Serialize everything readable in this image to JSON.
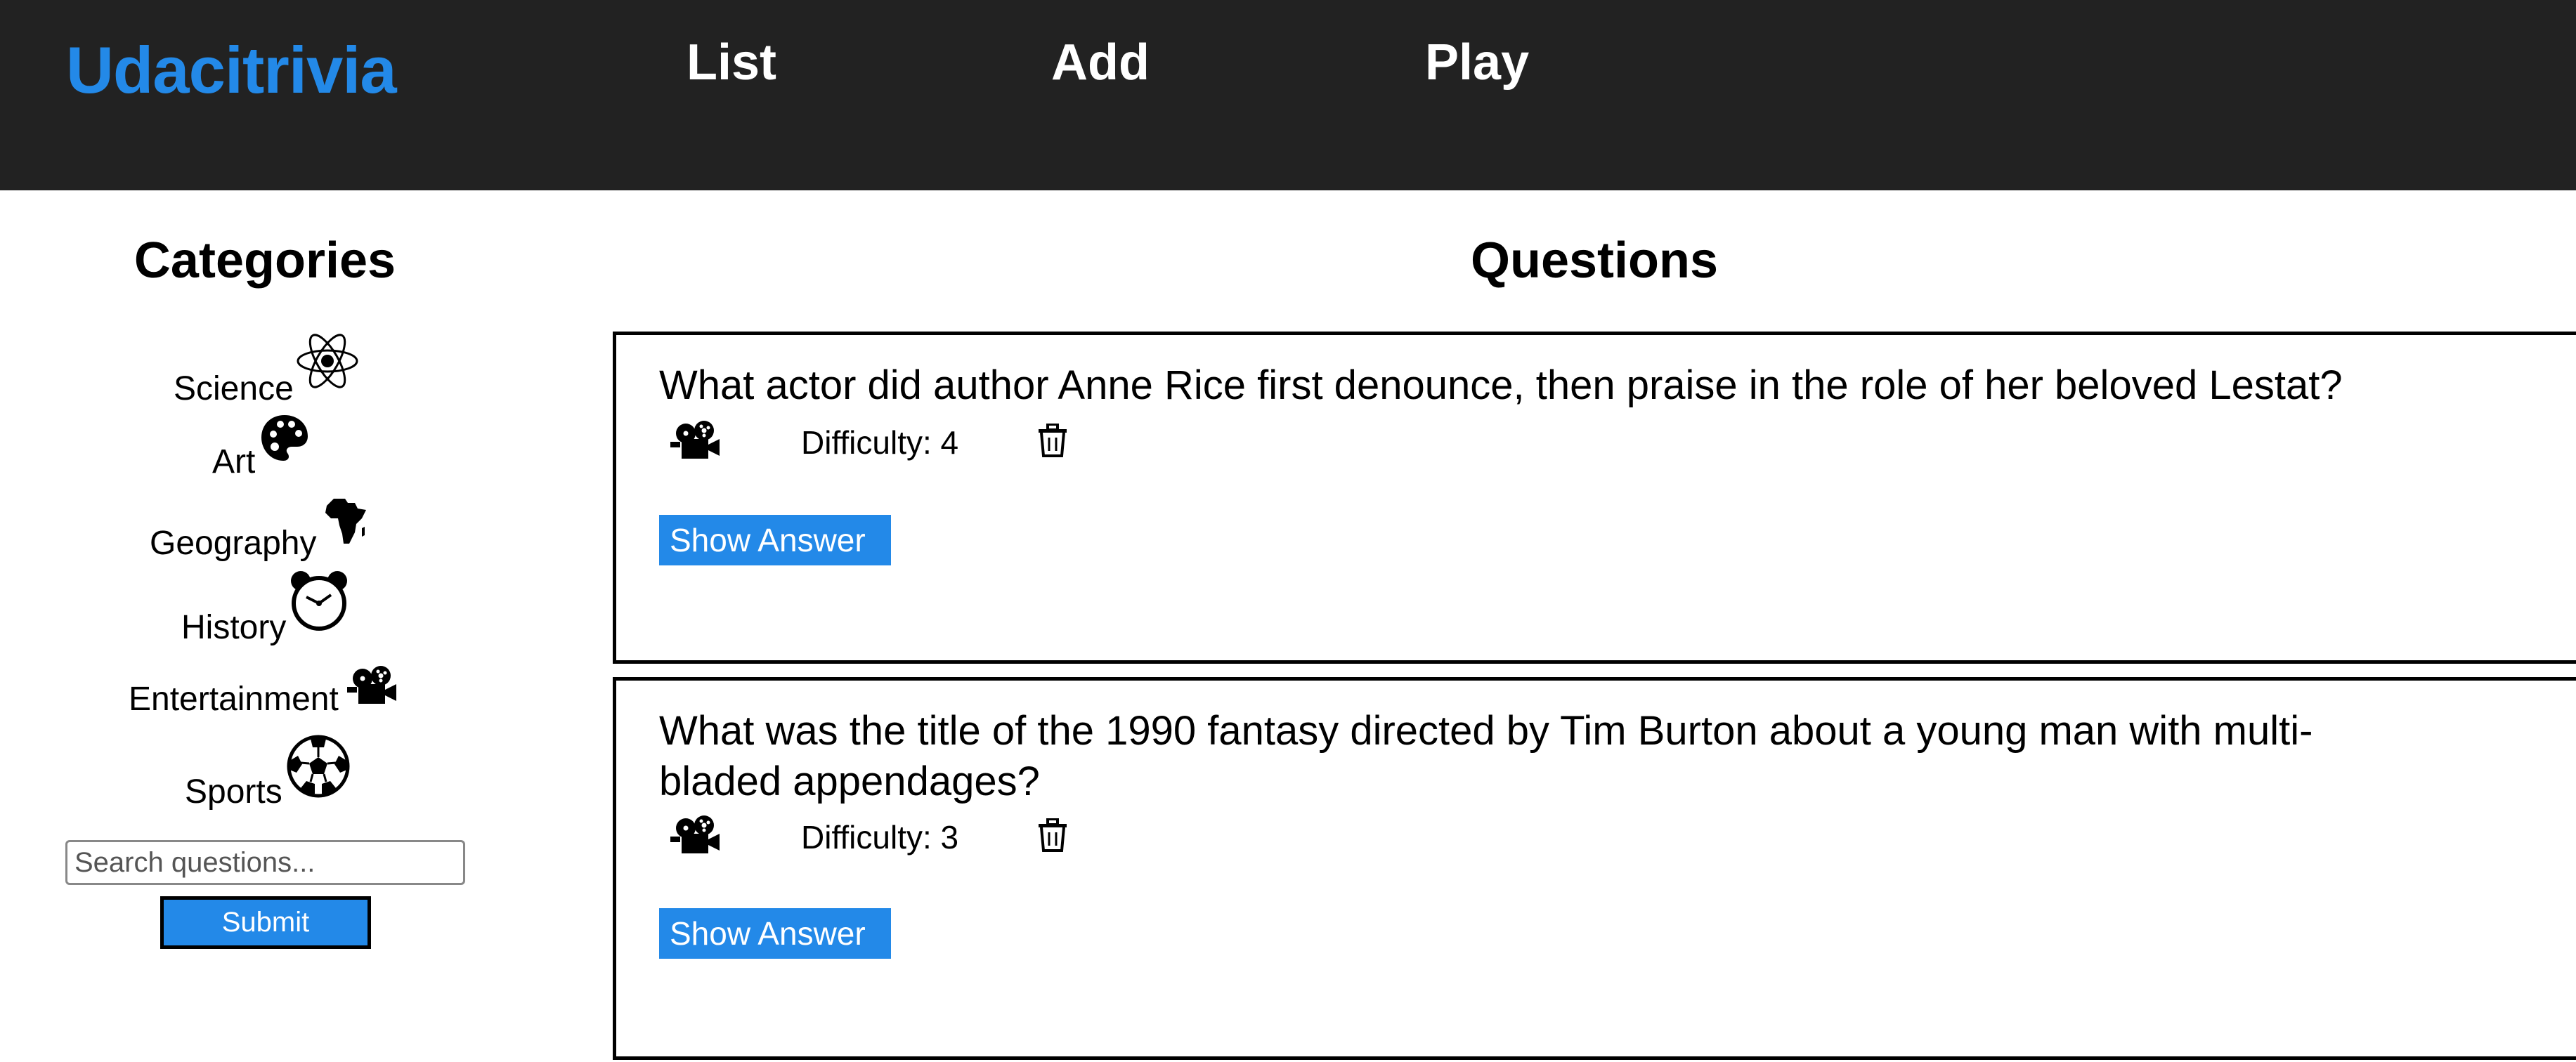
{
  "header": {
    "brand": "Udacitrivia",
    "nav": [
      "List",
      "Add",
      "Play"
    ]
  },
  "colors": {
    "header_bg": "#222222",
    "accent": "#2389e8",
    "text": "#000000"
  },
  "categories": {
    "title": "Categories",
    "items": [
      {
        "label": "Science",
        "icon": "atom-icon"
      },
      {
        "label": "Art",
        "icon": "palette-icon"
      },
      {
        "label": "Geography",
        "icon": "africa-map-icon"
      },
      {
        "label": "History",
        "icon": "alarm-clock-icon"
      },
      {
        "label": "Entertainment",
        "icon": "film-camera-icon"
      },
      {
        "label": "Sports",
        "icon": "soccer-ball-icon"
      }
    ]
  },
  "search": {
    "placeholder": "Search questions...",
    "submit_label": "Submit"
  },
  "questions": {
    "title": "Questions",
    "items": [
      {
        "text": "What actor did author Anne Rice first denounce, then praise in the role of her beloved Lestat?",
        "category_icon": "film-camera-icon",
        "difficulty": "Difficulty: 4",
        "show_answer_label": "Show Answer"
      },
      {
        "text": "What was the title of the 1990 fantasy directed by Tim Burton about a young man with multi-bladed appendages?",
        "category_icon": "film-camera-icon",
        "difficulty": "Difficulty: 3",
        "show_answer_label": "Show Answer"
      }
    ]
  }
}
